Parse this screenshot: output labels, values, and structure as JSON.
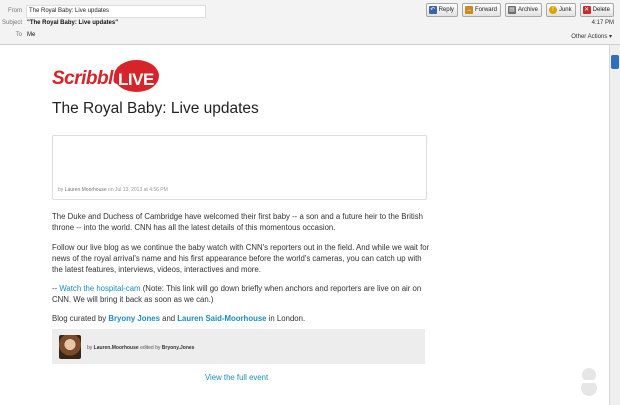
{
  "header": {
    "from_label": "From",
    "from_value": "The Royal Baby: Live updates",
    "subject_label": "Subject",
    "subject_value": "\"The Royal Baby: Live updates\"",
    "to_label": "To",
    "to_value": "Me",
    "time": "4:17 PM",
    "other_actions": "Other Actions ▾"
  },
  "toolbar": {
    "reply": "Reply",
    "forward": "Forward",
    "archive": "Archive",
    "junk": "Junk",
    "delete": "Delete"
  },
  "email": {
    "logo_scribble": "Scribble",
    "logo_live": "LIVE",
    "title": "The Royal Baby: Live updates",
    "post_meta_by": "by",
    "post_meta_author": "Lauren.Moorhouse",
    "post_meta_date": "on Jul 13, 2013 at 4:56 PM",
    "p1": "The Duke and Duchess of Cambridge have welcomed their first baby -- a son and a future heir to the British throne -- into the world. CNN has all the latest details of this momentous occasion.",
    "p2": "Follow our live blog as we continue the baby watch with CNN's reporters out in the field. And while we wait for news of the royal arrival's name and his first appearance before the world's cameras, you can catch up with the latest features, interviews, videos, interactives and more.",
    "p3_prefix": "-- ",
    "p3_link": "Watch the hospital-cam",
    "p3_rest": " (Note: This link will go down briefly when anchors and reporters are live on air on CNN. We will bring it back as soon as we can.)",
    "p4_prefix": "Blog curated by ",
    "p4_name1": "Bryony Jones",
    "p4_and": " and ",
    "p4_name2": "Lauren Said-Moorhouse",
    "p4_suffix": " in London.",
    "footer_by": "by",
    "footer_author": "Lauren.Moorhouse",
    "footer_edited": "edited by",
    "footer_editor": "Bryony.Jones",
    "view_full": "View the full event"
  },
  "colors": {
    "brand_red": "#d6242a",
    "link": "#1a8fb8"
  },
  "icons": [
    "reply-icon",
    "forward-icon",
    "archive-icon",
    "junk-icon",
    "delete-icon"
  ]
}
